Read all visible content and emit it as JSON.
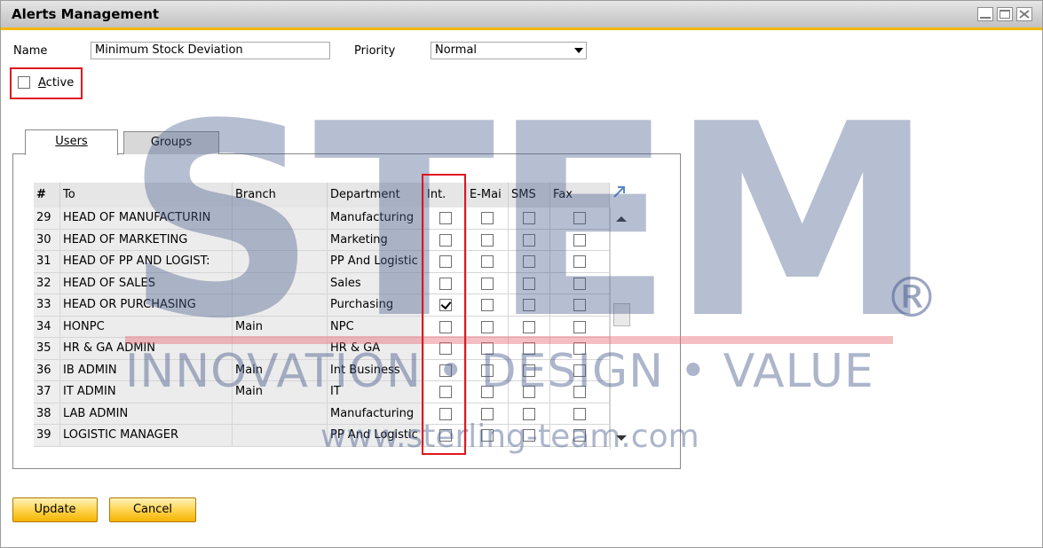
{
  "window": {
    "title": "Alerts Management",
    "controls": [
      "minimize-icon",
      "maximize-icon",
      "close-icon"
    ]
  },
  "form": {
    "name_label": "Name",
    "name_value": "Minimum Stock Deviation",
    "priority_label": "Priority",
    "priority_value": "Normal",
    "active_label": "Active",
    "active_checked": false
  },
  "tabs": [
    {
      "label": "Users",
      "selected": true
    },
    {
      "label": "Groups",
      "selected": false
    }
  ],
  "grid": {
    "columns": [
      "#",
      "To",
      "Branch",
      "Department",
      "Int.",
      "E-Mai",
      "SMS",
      "Fax"
    ],
    "rows": [
      {
        "num": "29",
        "to": "HEAD OF MANUFACTURIN",
        "branch": "",
        "department": "Manufacturing",
        "int": false,
        "email": false,
        "sms": false,
        "fax": false
      },
      {
        "num": "30",
        "to": "HEAD OF MARKETING",
        "branch": "",
        "department": "Marketing",
        "int": false,
        "email": false,
        "sms": false,
        "fax": false
      },
      {
        "num": "31",
        "to": "HEAD OF PP AND LOGIST:",
        "branch": "",
        "department": "PP And Logistic",
        "int": false,
        "email": false,
        "sms": false,
        "fax": false
      },
      {
        "num": "32",
        "to": "HEAD OF SALES",
        "branch": "",
        "department": "Sales",
        "int": false,
        "email": false,
        "sms": false,
        "fax": false
      },
      {
        "num": "33",
        "to": "HEAD OR PURCHASING",
        "branch": "",
        "department": "Purchasing",
        "int": true,
        "email": false,
        "sms": false,
        "fax": false
      },
      {
        "num": "34",
        "to": "HONPC",
        "branch": "Main",
        "department": "NPC",
        "int": false,
        "email": false,
        "sms": false,
        "fax": false
      },
      {
        "num": "35",
        "to": "HR & GA ADMIN",
        "branch": "",
        "department": "HR & GA",
        "int": false,
        "email": false,
        "sms": false,
        "fax": false
      },
      {
        "num": "36",
        "to": "IB ADMIN",
        "branch": "Main",
        "department": "Int Business",
        "int": false,
        "email": false,
        "sms": false,
        "fax": false
      },
      {
        "num": "37",
        "to": "IT ADMIN",
        "branch": "Main",
        "department": "IT",
        "int": false,
        "email": false,
        "sms": false,
        "fax": false
      },
      {
        "num": "38",
        "to": "LAB ADMIN",
        "branch": "",
        "department": "Manufacturing",
        "int": false,
        "email": false,
        "sms": false,
        "fax": false
      },
      {
        "num": "39",
        "to": "LOGISTIC MANAGER",
        "branch": "",
        "department": "PP And Logistic",
        "int": false,
        "email": false,
        "sms": false,
        "fax": false
      }
    ]
  },
  "buttons": {
    "update": "Update",
    "cancel": "Cancel"
  },
  "watermark": {
    "letters": "STEM",
    "registered": "®",
    "tagline": "INNOVATION • DESIGN • VALUE",
    "url": "www.sterling-team.com"
  },
  "colors": {
    "accent": "#f2b600",
    "highlight": "#e0161e",
    "button_top": "#fff2b8",
    "button_bottom": "#f4b400"
  }
}
